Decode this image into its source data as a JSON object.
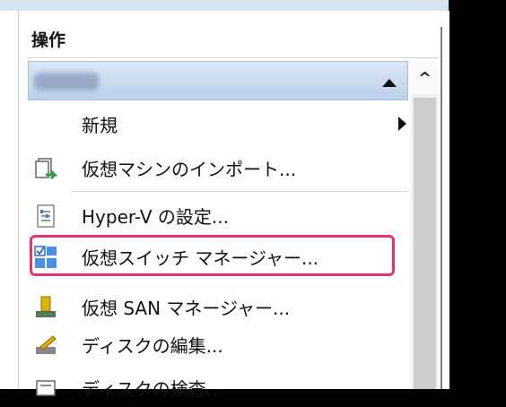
{
  "panel": {
    "title": "操作",
    "section_name": "",
    "items": [
      {
        "label": "新規",
        "icon": "none",
        "has_submenu": true
      },
      {
        "label": "仮想マシンのインポート...",
        "icon": "import-vm-icon"
      },
      {
        "label": "Hyper-V の設定...",
        "icon": "settings-document-icon"
      },
      {
        "label": "仮想スイッチ マネージャー...",
        "icon": "virtual-switch-icon",
        "highlighted": true
      },
      {
        "label": "仮想 SAN マネージャー...",
        "icon": "san-manager-icon"
      },
      {
        "label": "ディスクの編集...",
        "icon": "edit-disk-icon"
      },
      {
        "label": "ディスクの検査...",
        "icon": "inspect-disk-icon"
      }
    ]
  },
  "colors": {
    "highlight_border": "#e8336a",
    "section_bar": "#c8d8ee",
    "background": "#000000"
  }
}
